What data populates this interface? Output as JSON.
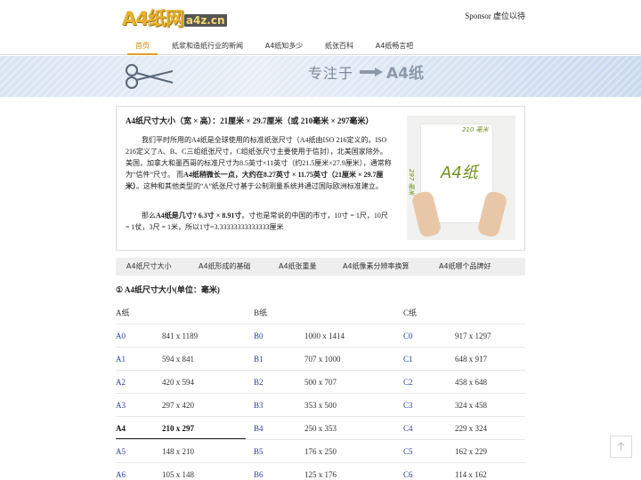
{
  "header": {
    "logo_main": "A4纸网",
    "logo_sub": "a4z.cn",
    "sponsor": "Sponsor 虚位以待"
  },
  "nav": [
    {
      "label": "首页",
      "active": true
    },
    {
      "label": "纸浆和造纸行业的新闻",
      "active": false
    },
    {
      "label": "A4纸知多少",
      "active": false
    },
    {
      "label": "纸张百科",
      "active": false
    },
    {
      "label": "A4纸畅言吧",
      "active": false
    }
  ],
  "banner": {
    "slogan": "专注于",
    "brand": "A4纸"
  },
  "intro": {
    "title": "A4纸尺寸大小（宽 × 高）：21厘米 × 29.7厘米（或 210毫米 × 297毫米）",
    "p1_a": "我们平时所用的A4纸是全球使用的标准纸张尺寸（A4纸由ISO 216定义的。ISO 216定义了A、B、C三组纸张尺寸，C组纸张尺寸主要使用于信封），北美国家除外。美国，加拿大和墨西哥的标准尺寸为8.5英寸×11英寸（约21.5厘米×27.9厘米），通常称为“信件”尺寸。 而",
    "p1_b": "A4纸稍微长一点，大约在8.27英寸 × 11.75英寸（21厘米 × 29.7厘米）",
    "p1_c": "。这种和其他类型的“A”纸张尺寸基于公制测量系统并通过国际欧洲标准建立。",
    "p2_a": "那么",
    "p2_b": "A4纸是几寸? 6.3寸 × 8.91寸",
    "p2_c": "。寸也是常说的中国的市寸，10寸 = 1尺，10尺 = 1仗，3尺 = 1米，所以1寸=3.33333333333333厘米",
    "image": {
      "top_label": "210 毫米",
      "side_label": "297 毫米",
      "paper_label": "A4纸"
    }
  },
  "tabs": [
    "A4纸尺寸大小",
    "A4纸形成的基础",
    "A4纸张重量",
    "A4纸像素分辨率换算",
    "A4纸哪个品牌好"
  ],
  "section_title": "① A4纸尺寸大小(单位：毫米)",
  "table": {
    "headers": [
      "A纸",
      "B纸",
      "C纸"
    ],
    "rows": [
      {
        "a": "A0",
        "a_size": "841 x 1189",
        "b": "B0",
        "b_size": "1000 x 1414",
        "c": "C0",
        "c_size": "917 x 1297"
      },
      {
        "a": "A1",
        "a_size": "594 x 841",
        "b": "B1",
        "b_size": "707 x 1000",
        "c": "C1",
        "c_size": "648 x 917"
      },
      {
        "a": "A2",
        "a_size": "420 x 594",
        "b": "B2",
        "b_size": "500 x 707",
        "c": "C2",
        "c_size": "458 x 648"
      },
      {
        "a": "A3",
        "a_size": "297 x 420",
        "b": "B3",
        "b_size": "353 x 500",
        "c": "C3",
        "c_size": "324 x 458"
      },
      {
        "a": "A4",
        "a_size": "210 x 297",
        "b": "B4",
        "b_size": "250 x 353",
        "c": "C4",
        "c_size": "229 x 324"
      },
      {
        "a": "A5",
        "a_size": "148 x 210",
        "b": "B5",
        "b_size": "176 x 250",
        "c": "C5",
        "c_size": "162 x 229"
      },
      {
        "a": "A6",
        "a_size": "105 x 148",
        "b": "B6",
        "b_size": "125 x 176",
        "c": "C6",
        "c_size": "114 x 162"
      }
    ]
  },
  "colors": {
    "accent": "#e0a020",
    "link": "#2a3fa6",
    "tab_bg": "#eeeeee"
  },
  "icons": {
    "scissors": "scissors-icon",
    "arrow": "arrow-right-icon",
    "back_to_top": "arrow-up-icon"
  }
}
